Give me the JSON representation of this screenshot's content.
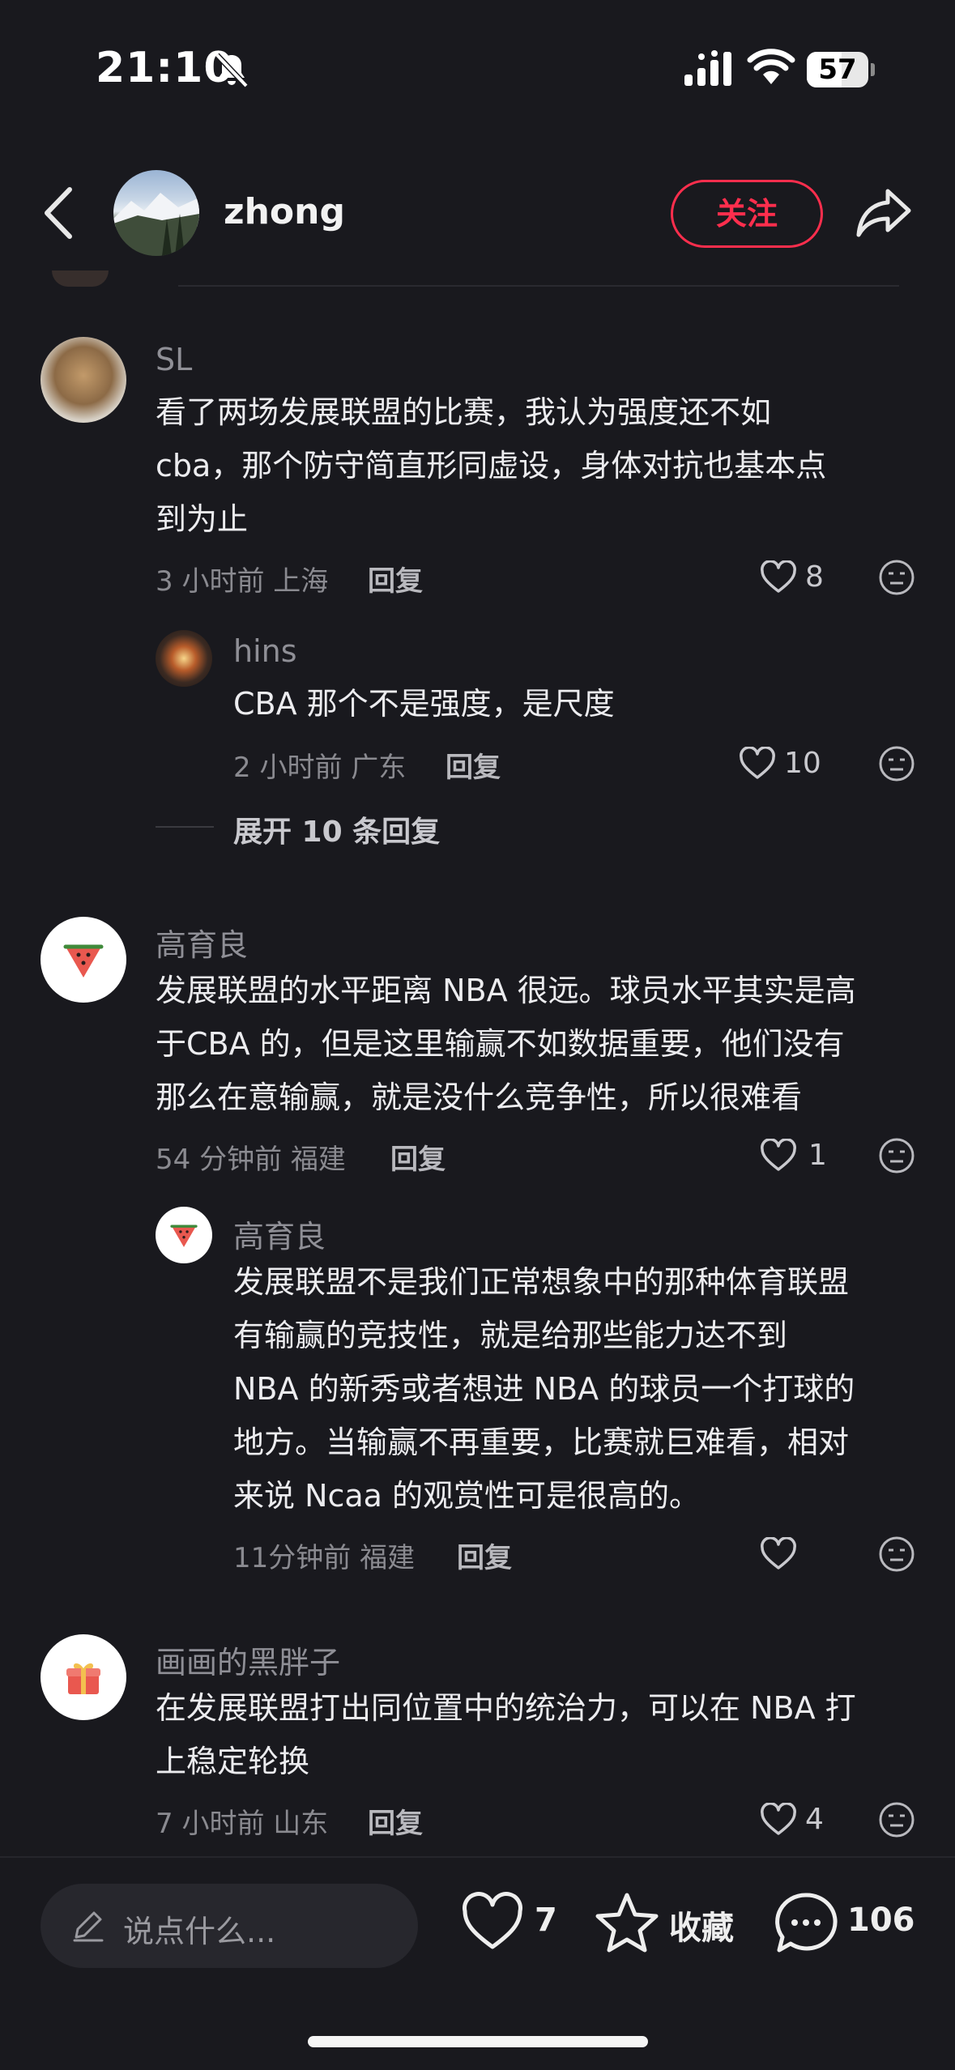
{
  "status_bar": {
    "time": "21:10",
    "battery": "57",
    "battery_level": 0.57
  },
  "header": {
    "username": "zhong",
    "follow_label": "关注"
  },
  "comments": [
    {
      "name": "SL",
      "lines": [
        "看了两场发展联盟的比赛，我认为强度还不如",
        "cba，那个防守简直形同虚设，身体对抗也基本点",
        "到为止"
      ],
      "meta": "3 小时前 上海",
      "reply": "回复",
      "likes": "8",
      "replies": [
        {
          "name": "hins",
          "lines": [
            "CBA 那个不是强度，是尺度"
          ],
          "meta": "2 小时前 广东",
          "reply": "回复",
          "likes": "10"
        }
      ],
      "expand": "展开 10 条回复"
    },
    {
      "name": "高育良",
      "lines": [
        "发展联盟的水平距离 NBA 很远。球员水平其实是高",
        "于CBA 的，但是这里输赢不如数据重要，他们没有",
        "那么在意输赢，就是没什么竞争性，所以很难看"
      ],
      "meta": "54 分钟前 福建",
      "reply": "回复",
      "likes": "1",
      "replies": [
        {
          "name": "高育良",
          "lines": [
            "发展联盟不是我们正常想象中的那种体育联盟",
            "有输赢的竞技性，就是给那些能力达不到",
            "NBA 的新秀或者想进 NBA 的球员一个打球的",
            "地方。当输赢不再重要，比赛就巨难看，相对",
            "来说 Ncaa 的观赏性可是很高的。"
          ],
          "meta": "11分钟前 福建",
          "reply": "回复",
          "likes": ""
        }
      ]
    },
    {
      "name": "画画的黑胖子",
      "lines": [
        "在发展联盟打出同位置中的统治力，可以在 NBA 打",
        "上稳定轮换"
      ],
      "meta": "7 小时前 山东",
      "reply": "回复",
      "likes": "4"
    }
  ],
  "bottom_bar": {
    "input_placeholder": "说点什么...",
    "likes": "7",
    "favorite_label": "收藏",
    "comments": "106"
  },
  "icons": [
    "bell-slash-icon",
    "signal-icon",
    "wifi-icon",
    "battery-icon",
    "back-icon",
    "share-icon",
    "heart-icon",
    "emoji-icon",
    "pen-icon",
    "star-icon",
    "comment-icon",
    "watermelon-icon",
    "gift-icon"
  ],
  "colors": {
    "background": "#19191e",
    "accent": "#ff2e4d"
  }
}
